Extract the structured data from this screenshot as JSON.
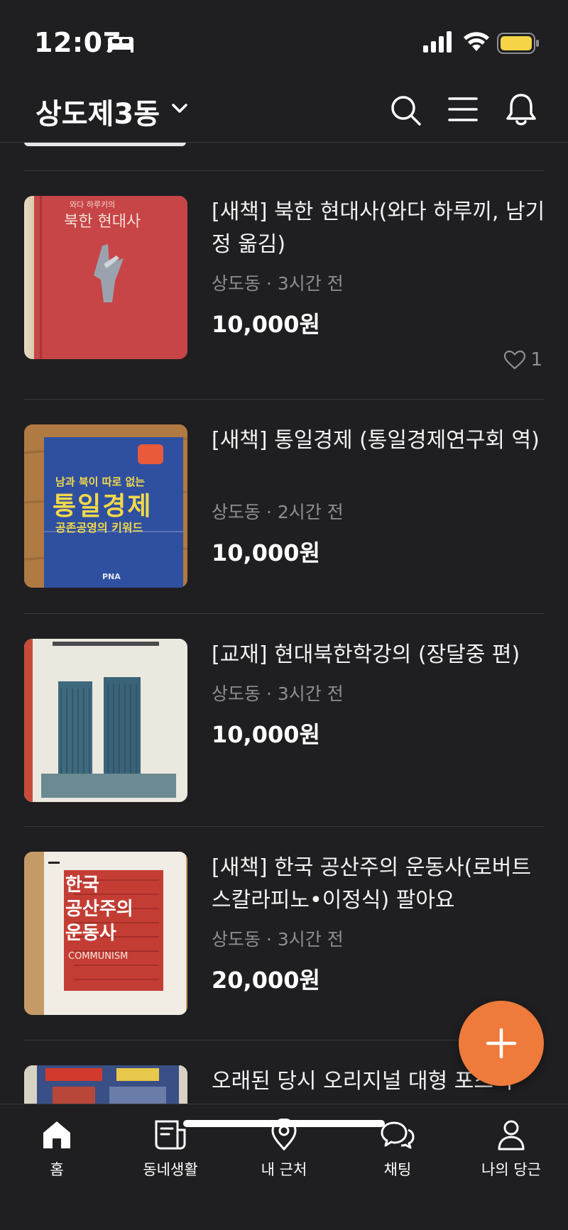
{
  "status_bar": {
    "time": "12:07"
  },
  "header": {
    "location": "상도제3동"
  },
  "items": [
    {
      "title": "[새책] 북한 현대사(와다 하루끼, 남기정 옮김)",
      "location": "상도동",
      "time": "3시간 전",
      "price": "10,000원",
      "likes": "1",
      "thumb": {
        "cover_title": "북한 현대사",
        "cover_subtitle": "와다 하루키의"
      }
    },
    {
      "title": "[새책] 통일경제 (통일경제연구회 역)",
      "location": "상도동",
      "time": "2시간 전",
      "price": "10,000원",
      "thumb": {
        "cover_line1": "남과 북이 따로 없는",
        "cover_title": "통일경제",
        "cover_line2": "공존공영의 키워드",
        "publisher": "PNA"
      }
    },
    {
      "title": "[교재] 현대북한학강의 (장달중 편)",
      "location": "상도동",
      "time": "3시간 전",
      "price": "10,000원"
    },
    {
      "title": "[새책] 한국 공산주의 운동사(로버트 스칼라피노•이정식) 팔아요",
      "location": "상도동",
      "time": "3시간 전",
      "price": "20,000원",
      "thumb": {
        "cover_title_1": "한국",
        "cover_title_2": "공산주의",
        "cover_title_3": "운동사",
        "cover_en": "COMMUNISM"
      }
    },
    {
      "title": "오래된 당시 오리지널 대형 포스터"
    }
  ],
  "bottom_nav": [
    {
      "label": "홈",
      "icon": "home-icon"
    },
    {
      "label": "동네생활",
      "icon": "newspaper-icon"
    },
    {
      "label": "내 근처",
      "icon": "location-pin-icon"
    },
    {
      "label": "채팅",
      "icon": "chat-icon"
    },
    {
      "label": "나의 당근",
      "icon": "person-icon"
    }
  ],
  "colors": {
    "accent": "#ee7a3b",
    "background": "#1f1f21",
    "battery": "#f5d547"
  }
}
